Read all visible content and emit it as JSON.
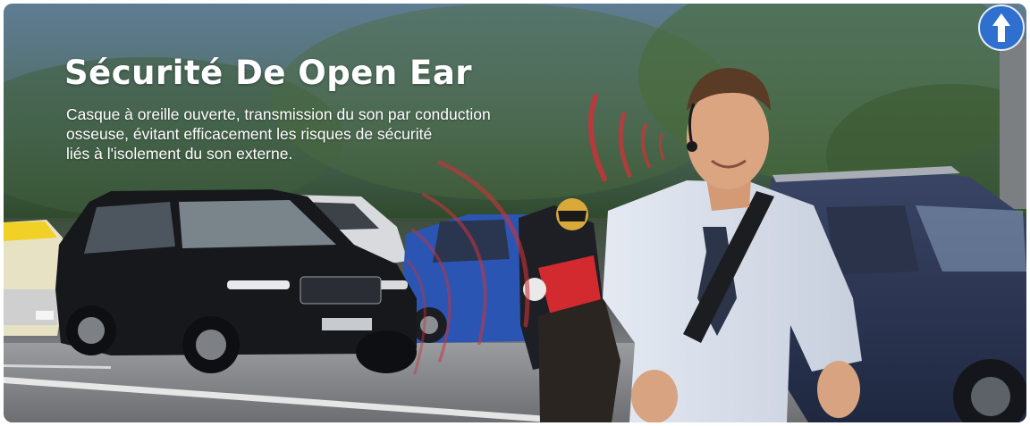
{
  "banner": {
    "title": "Sécurité De Open Ear",
    "description_lines": [
      "Casque à oreille ouverte, transmission du son par conduction",
      "osseuse, évitant efficacement les risques de sécurité",
      "liés à l'isolement du son externe."
    ]
  },
  "colors": {
    "accent_sound_waves": "#c8343a",
    "sign_blue": "#2f6fd0",
    "text": "#ffffff"
  },
  "icons": {
    "road_sign": "arrow-up-icon"
  }
}
